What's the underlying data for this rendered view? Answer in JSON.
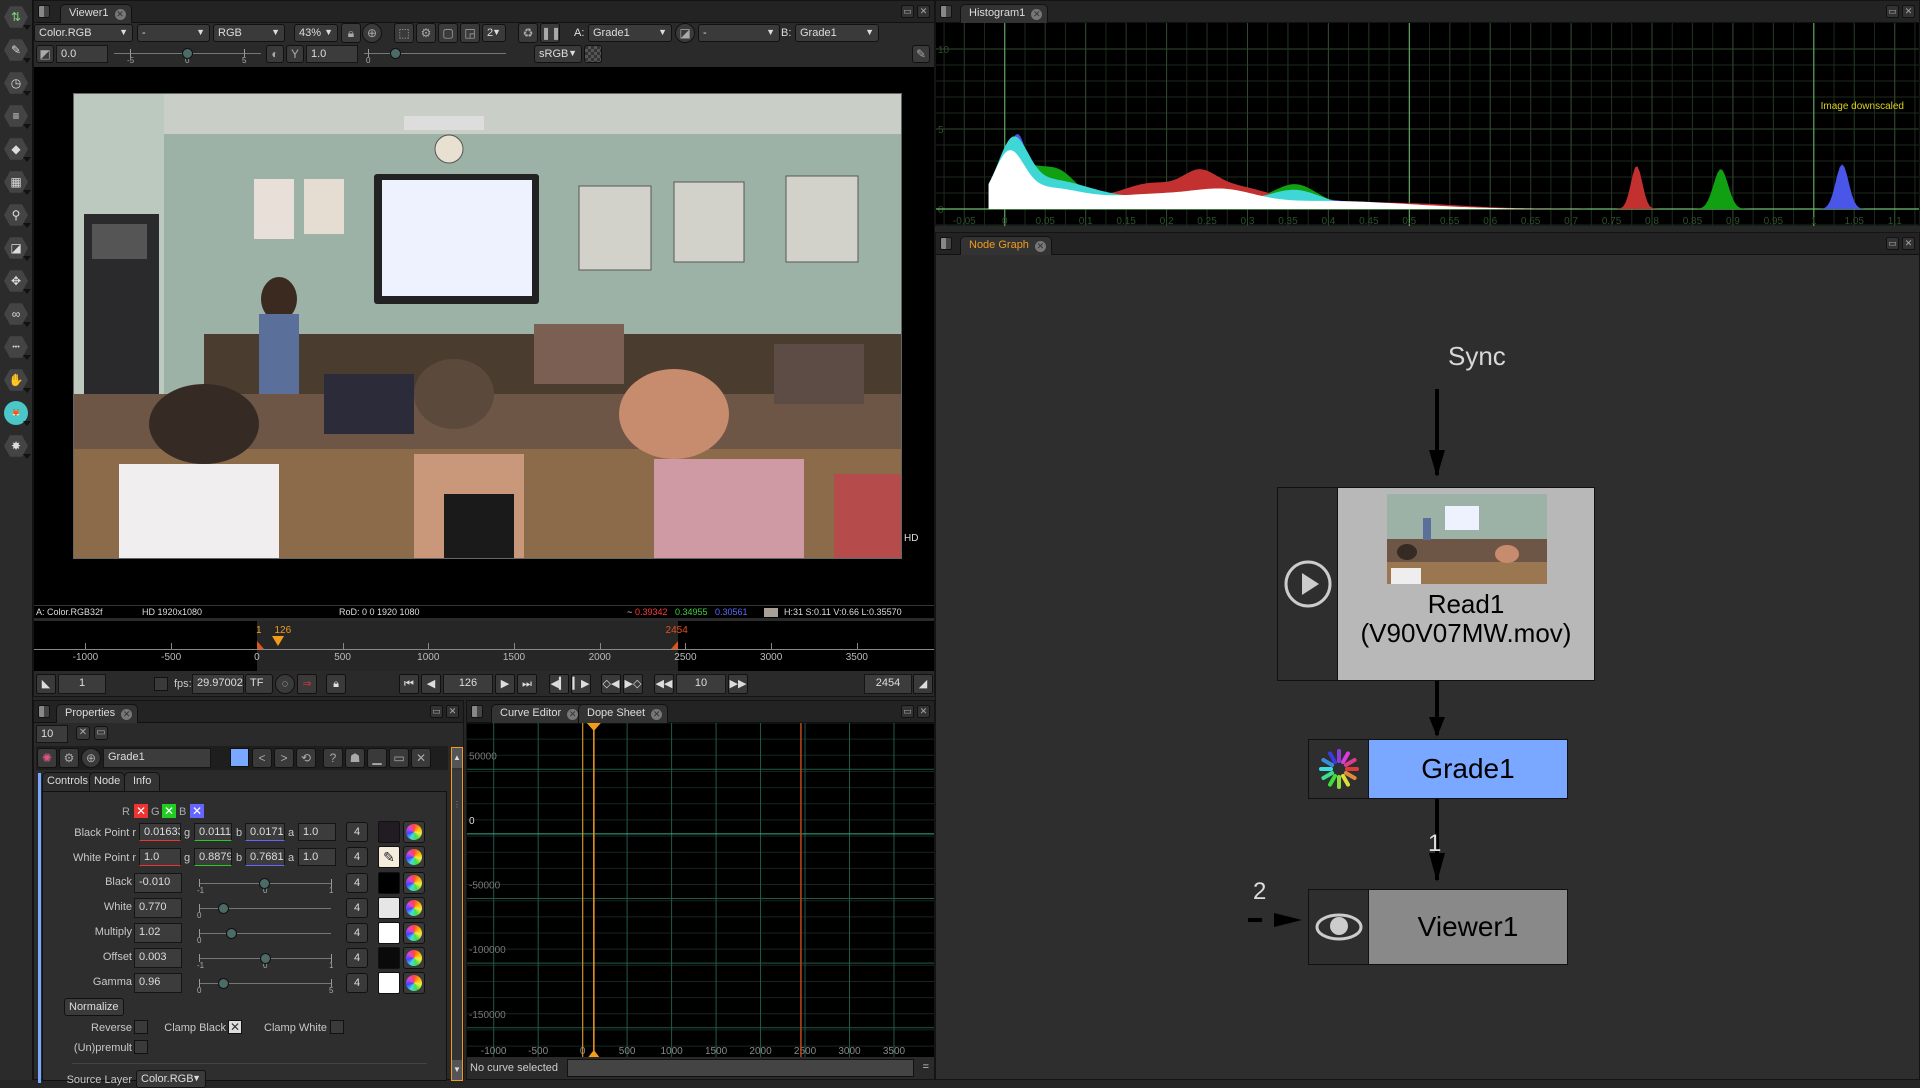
{
  "toolbar": {
    "tools": [
      {
        "name": "image-tools-icon",
        "glyph": "⇅"
      },
      {
        "name": "draw-tools-icon",
        "glyph": "✎"
      },
      {
        "name": "time-tools-icon",
        "glyph": "◷"
      },
      {
        "name": "channel-tools-icon",
        "glyph": "≡"
      },
      {
        "name": "color-tools-icon",
        "glyph": "◆"
      },
      {
        "name": "filter-tools-icon",
        "glyph": "▦"
      },
      {
        "name": "keyer-tools-icon",
        "glyph": "⚲"
      },
      {
        "name": "merge-tools-icon",
        "glyph": "◪"
      },
      {
        "name": "transform-tools-icon",
        "glyph": "✥"
      },
      {
        "name": "views-tools-icon",
        "glyph": "∞"
      },
      {
        "name": "other-tools-icon",
        "glyph": "•••"
      },
      {
        "name": "gmic-tools-icon",
        "glyph": "✋"
      },
      {
        "name": "extra-plugins-icon",
        "glyph": "🦊"
      },
      {
        "name": "misc-tools-icon",
        "glyph": "✸"
      }
    ]
  },
  "viewer": {
    "tab": "Viewer1",
    "layer": "Color.RGB",
    "alpha_channel": "-",
    "display_channels": "RGB",
    "zoom": "43%",
    "proxy_level": "2",
    "input_a_label": "A:",
    "input_a": "Grade1",
    "composite_op": "-",
    "input_b_label": "B:",
    "input_b": "Grade1",
    "gain": "0.0",
    "gain_ticks": [
      "-5",
      "0",
      "5"
    ],
    "gamma": "1.0",
    "gamma_ticks": [
      "0"
    ],
    "colorspace": "sRGB",
    "hd_badge": "HD",
    "info": {
      "layer_format": "A: Color.RGB32f",
      "resolution": "HD 1920x1080",
      "rod": "RoD: 0 0 1920 1080",
      "pixel_prefix": "~",
      "r": "0.39342",
      "g": "0.34955",
      "b": "0.30561",
      "hsv": "H:31 S:0.11 V:0.66 L:0.35570",
      "colors": {
        "r": "#ff3b3b",
        "g": "#3bd13b",
        "b": "#5a6bff"
      }
    },
    "timeline": {
      "ticks": [
        "-1000",
        "-500",
        "0",
        "500",
        "1000",
        "1500",
        "2000",
        "2500",
        "3000",
        "3500"
      ],
      "first_frame_marker": "1",
      "current_frame_marker": "126",
      "last_frame_marker": "2454",
      "range_min": -1300,
      "range_max": 3950,
      "first": 1,
      "current": 126,
      "last": 2454,
      "marker_color": "#f39c1c",
      "end_color": "#e0541a"
    },
    "playback": {
      "in_point": "1",
      "fps_label": "fps:",
      "fps": "29.97002",
      "turbo": "TF",
      "current_frame": "126",
      "frame_increment": "10",
      "out_point": "2454"
    }
  },
  "histogram": {
    "tab": "Histogram1",
    "note": "Image downscaled",
    "x_ticks": [
      "-0.05",
      "0",
      "0.05",
      "0.1",
      "0.15",
      "0.2",
      "0.25",
      "0.3",
      "0.35",
      "0.4",
      "0.45",
      "0.5",
      "0.55",
      "0.6",
      "0.65",
      "0.7",
      "0.75",
      "0.8",
      "0.85",
      "0.9",
      "0.95",
      "1",
      "1.05",
      "1.1"
    ],
    "y_ticks": [
      "0",
      "5",
      "10"
    ]
  },
  "node_graph": {
    "tab": "Node Graph",
    "sync_label": "Sync",
    "nodes": {
      "read": {
        "name": "Read1",
        "file": "(V90V07MW.mov)"
      },
      "grade": {
        "name": "Grade1",
        "color": "#7aa7ff"
      },
      "viewer": {
        "name": "Viewer1"
      }
    },
    "edge_labels": {
      "grade_to_viewer": "1",
      "viewer_input2": "2"
    }
  },
  "properties": {
    "tab": "Properties",
    "max_panels": "10",
    "node_name": "Grade1",
    "node_color": "#7aa7ff",
    "tabs": [
      "Controls",
      "Node",
      "Info"
    ],
    "channel_labels": {
      "r": "R",
      "g": "G",
      "b": "B"
    },
    "params": {
      "black_point": {
        "label": "Black Point",
        "r": "0.01633",
        "g": "0.0111",
        "b": "0.0171",
        "a": "1.0",
        "dims": "4",
        "swatch": "#211b22"
      },
      "white_point": {
        "label": "White Point",
        "r": "1.0",
        "g": "0.8879",
        "b": "0.7681",
        "a": "1.0",
        "dims": "4"
      },
      "black": {
        "label": "Black",
        "value": "-0.010",
        "dims": "4",
        "ticks": [
          "-1",
          "0",
          "1"
        ],
        "slider_fraction": 0.495,
        "swatch": "#000000"
      },
      "white": {
        "label": "White",
        "value": "0.770",
        "dims": "4",
        "ticks": [
          "0"
        ],
        "slider_fraction": 0.18,
        "swatch": "#e6e6e6"
      },
      "multiply": {
        "label": "Multiply",
        "value": "1.02",
        "dims": "4",
        "ticks": [
          "0"
        ],
        "slider_fraction": 0.24,
        "swatch": "#ffffff"
      },
      "offset": {
        "label": "Offset",
        "value": "0.003",
        "dims": "4",
        "ticks": [
          "-1",
          "0",
          "1"
        ],
        "slider_fraction": 0.5,
        "swatch": "#0a0a0a"
      },
      "gamma": {
        "label": "Gamma",
        "value": "0.96",
        "dims": "4",
        "ticks": [
          "0",
          "5"
        ],
        "slider_fraction": 0.18,
        "swatch": "#ffffff"
      }
    },
    "channel_letters": {
      "r": "r",
      "g": "g",
      "b": "b",
      "a": "a"
    },
    "normalize_label": "Normalize",
    "reverse_label": "Reverse",
    "reverse": false,
    "clamp_black_label": "Clamp Black",
    "clamp_black": true,
    "clamp_white_label": "Clamp White",
    "clamp_white": false,
    "premult_label": "(Un)premult",
    "premult": false,
    "source_layer_label": "Source Layer",
    "source_layer": "Color.RGB"
  },
  "curve_editor": {
    "tabs": [
      "Curve Editor",
      "Dope Sheet"
    ],
    "y_ticks": [
      "50000",
      "0",
      "-50000",
      "-100000",
      "-150000"
    ],
    "x_ticks": [
      "-1000",
      "-500",
      "0",
      "500",
      "1000",
      "1500",
      "2000",
      "2500",
      "3000",
      "3500"
    ],
    "status": "No curve selected",
    "expr_button": "="
  }
}
